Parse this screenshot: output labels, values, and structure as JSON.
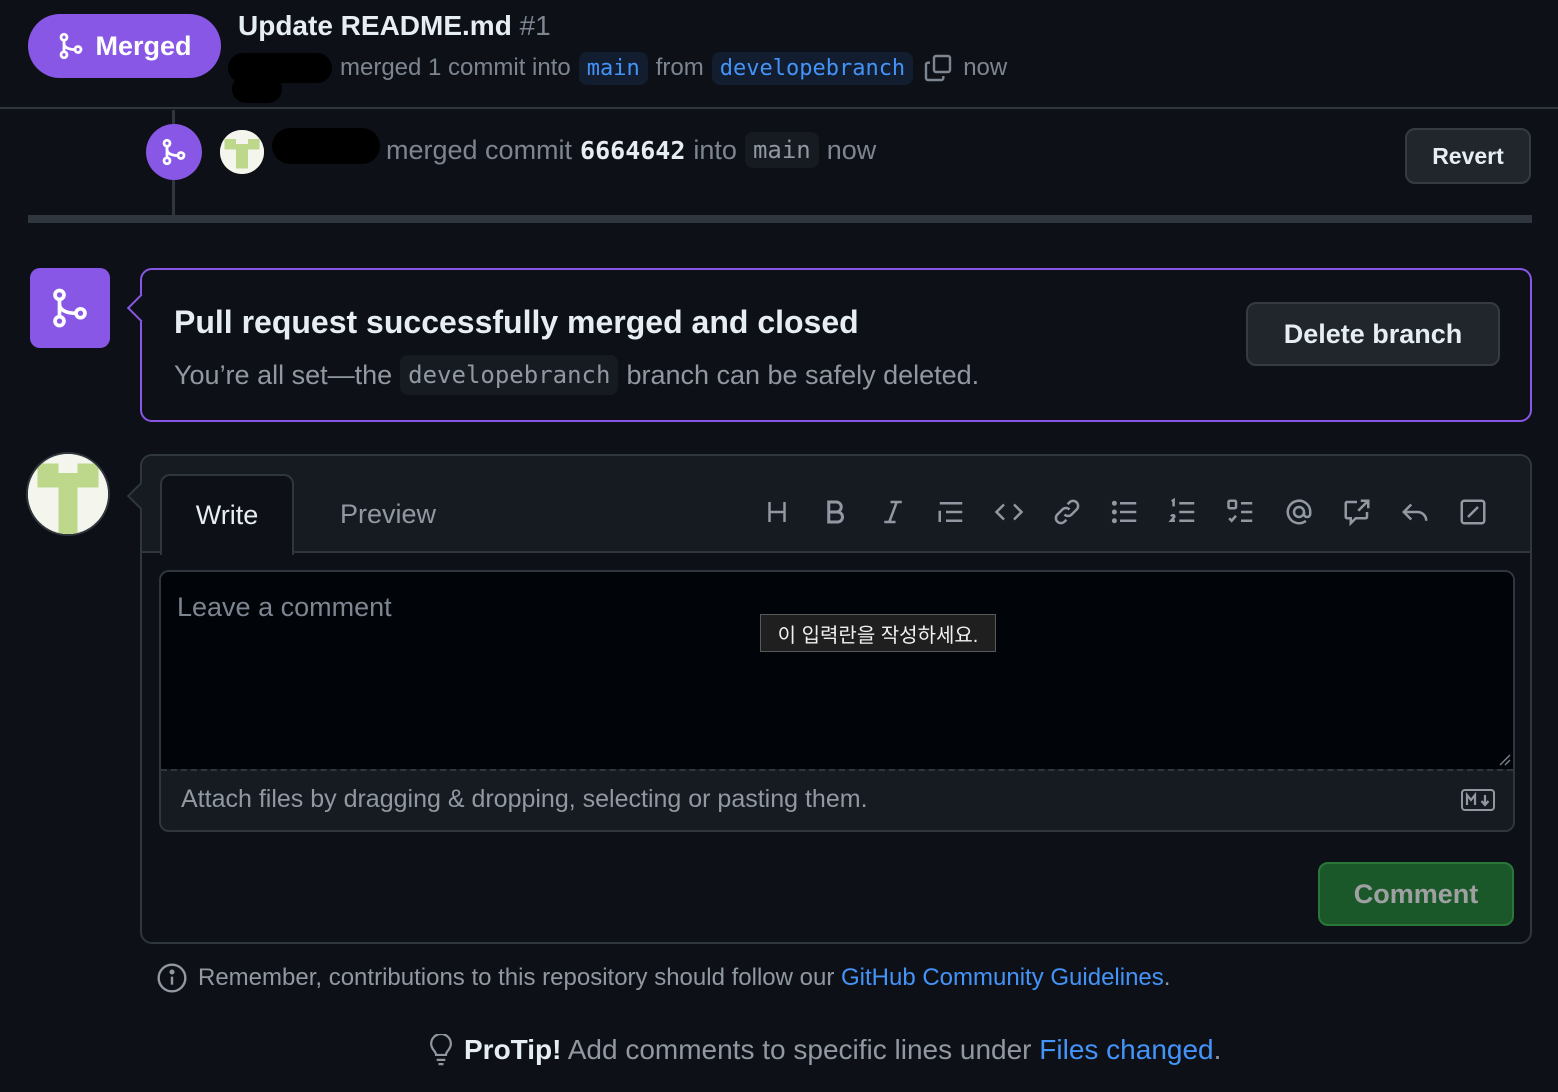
{
  "header": {
    "status_badge": "Merged",
    "title": "Update README.md",
    "pr_number": "#1",
    "meta_text": "merged 1 commit into",
    "base_branch": "main",
    "from_text": "from",
    "head_branch": "developebranch",
    "time": "now"
  },
  "timeline": {
    "event_text": "merged commit",
    "commit_sha": "6664642",
    "into_text": "into",
    "branch": "main",
    "time": "now",
    "revert_label": "Revert"
  },
  "merge_status": {
    "title": "Pull request successfully merged and closed",
    "desc_before": "You’re all set—the",
    "branch": "developebranch",
    "desc_after": "branch can be safely deleted.",
    "delete_label": "Delete branch"
  },
  "comment": {
    "tabs": [
      "Write",
      "Preview"
    ],
    "placeholder": "Leave a comment",
    "tooltip": "이 입력란을 작성하세요.",
    "attach_text": "Attach files by dragging & dropping, selecting or pasting them.",
    "submit_label": "Comment",
    "toolbar_icons": [
      "heading-icon",
      "bold-icon",
      "italic-icon",
      "quote-icon",
      "code-icon",
      "link-icon",
      "unordered-list-icon",
      "ordered-list-icon",
      "task-list-icon",
      "mention-icon",
      "cross-reference-icon",
      "reply-icon",
      "slash-command-icon"
    ]
  },
  "footer": {
    "guidelines_text": "Remember, contributions to this repository should follow our",
    "guidelines_link": "GitHub Community Guidelines",
    "guidelines_end": ".",
    "protip_label": "ProTip!",
    "protip_text": "Add comments to specific lines under",
    "protip_link": "Files changed",
    "protip_end": "."
  },
  "colors": {
    "merged_purple": "#8957e5",
    "link_blue": "#4493f8",
    "comment_green": "#238636",
    "background": "#0d1117"
  }
}
